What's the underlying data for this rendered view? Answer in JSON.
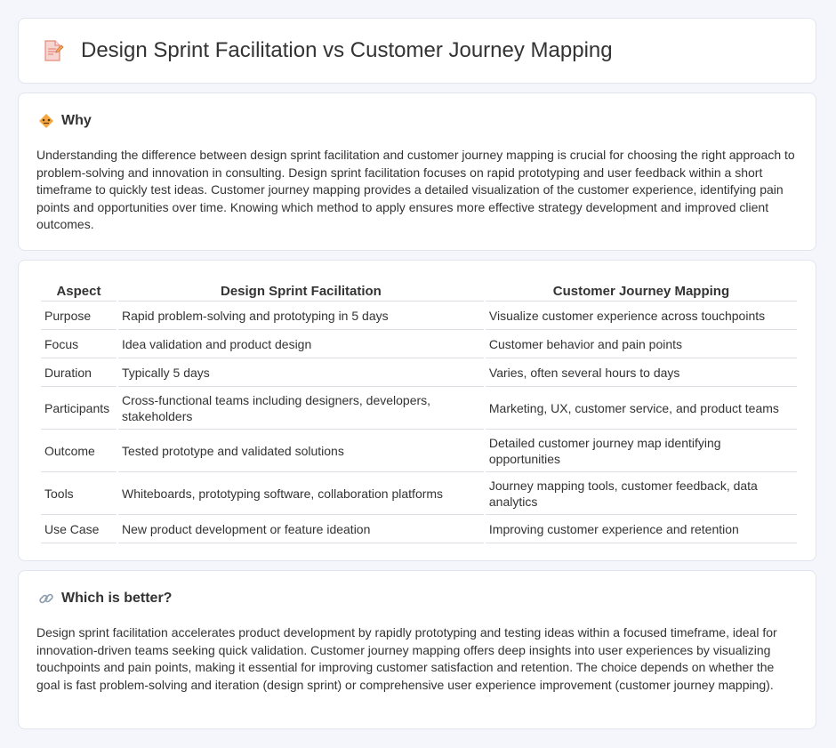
{
  "page": {
    "title": "Design Sprint Facilitation vs Customer Journey Mapping"
  },
  "why": {
    "heading": "Why",
    "icon": "diamond-warning-icon",
    "text": "Understanding the difference between design sprint facilitation and customer journey mapping is crucial for choosing the right approach to problem-solving and innovation in consulting. Design sprint facilitation focuses on rapid prototyping and user feedback within a short timeframe to quickly test ideas. Customer journey mapping provides a detailed visualization of the customer experience, identifying pain points and opportunities over time. Knowing which method to apply ensures more effective strategy development and improved client outcomes."
  },
  "table": {
    "headers": [
      "Aspect",
      "Design Sprint Facilitation",
      "Customer Journey Mapping"
    ],
    "rows": [
      [
        "Purpose",
        "Rapid problem-solving and prototyping in 5 days",
        "Visualize customer experience across touchpoints"
      ],
      [
        "Focus",
        "Idea validation and product design",
        "Customer behavior and pain points"
      ],
      [
        "Duration",
        "Typically 5 days",
        "Varies, often several hours to days"
      ],
      [
        "Participants",
        "Cross-functional teams including designers, developers, stakeholders",
        "Marketing, UX, customer service, and product teams"
      ],
      [
        "Outcome",
        "Tested prototype and validated solutions",
        "Detailed customer journey map identifying opportunities"
      ],
      [
        "Tools",
        "Whiteboards, prototyping software, collaboration platforms",
        "Journey mapping tools, customer feedback, data analytics"
      ],
      [
        "Use Case",
        "New product development or feature ideation",
        "Improving customer experience and retention"
      ]
    ]
  },
  "better": {
    "heading": "Which is better?",
    "icon": "link-icon",
    "text": "Design sprint facilitation accelerates product development by rapidly prototyping and testing ideas within a focused timeframe, ideal for innovation-driven teams seeking quick validation. Customer journey mapping offers deep insights into user experiences by visualizing touchpoints and pain points, making it essential for improving customer satisfaction and retention. The choice depends on whether the goal is fast problem-solving and iteration (design sprint) or comprehensive user experience improvement (customer journey mapping)."
  },
  "colors": {
    "page_background": "#f4f6fb",
    "card_background": "#ffffff",
    "text": "#333333",
    "icon_accent": "#f0a040"
  }
}
